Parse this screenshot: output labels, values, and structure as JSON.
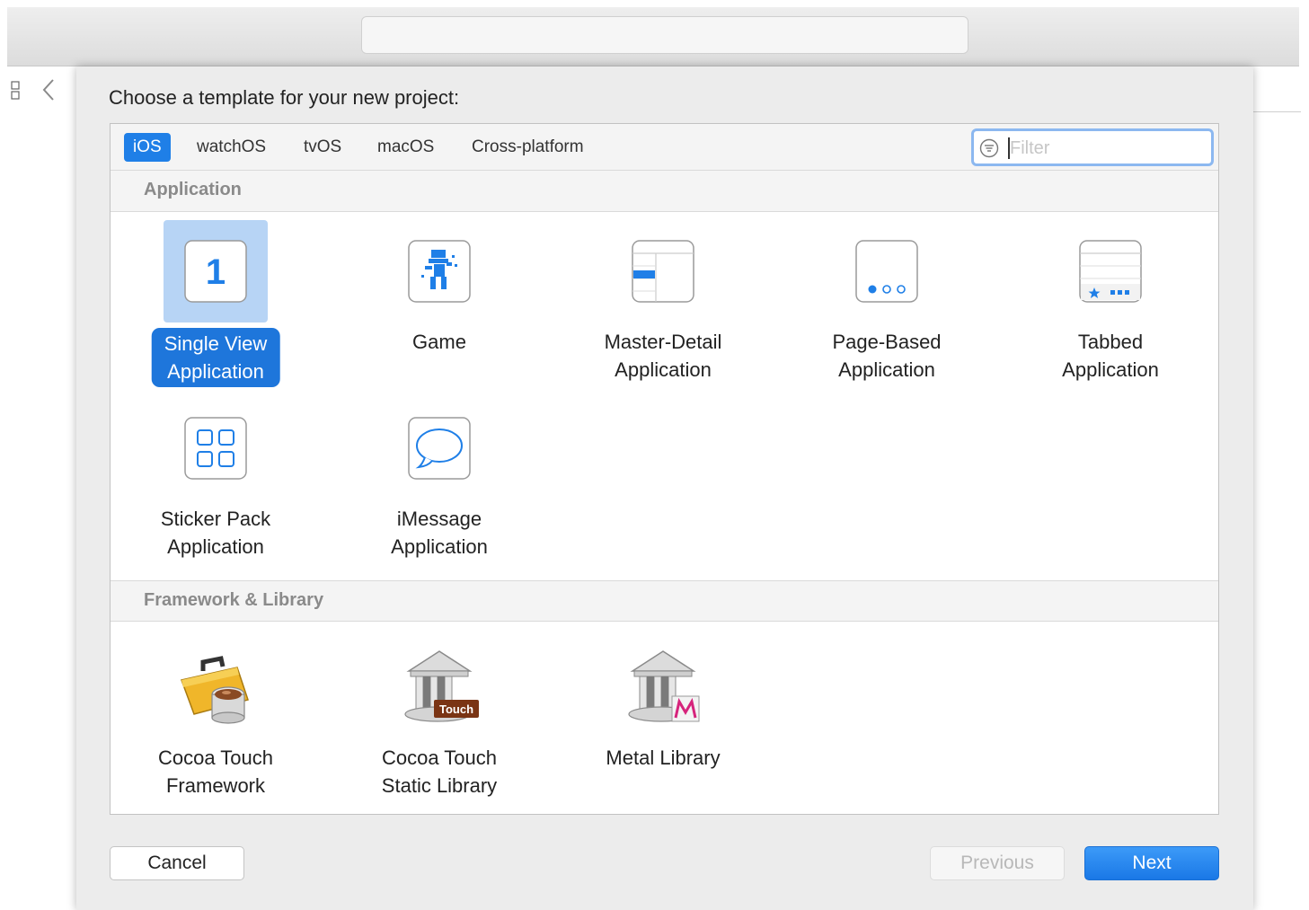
{
  "window": {
    "title_field": ""
  },
  "dialog": {
    "title": "Choose a template for your new project:",
    "platform_tabs": [
      {
        "label": "iOS",
        "selected": true
      },
      {
        "label": "watchOS",
        "selected": false
      },
      {
        "label": "tvOS",
        "selected": false
      },
      {
        "label": "macOS",
        "selected": false
      },
      {
        "label": "Cross-platform",
        "selected": false
      }
    ],
    "filter": {
      "placeholder": "Filter",
      "value": ""
    },
    "sections": [
      {
        "title": "Application",
        "templates": [
          {
            "line1": "Single View",
            "line2": "Application",
            "icon": "single-view-icon",
            "selected": true
          },
          {
            "line1": "Game",
            "line2": "",
            "icon": "game-icon",
            "selected": false
          },
          {
            "line1": "Master-Detail",
            "line2": "Application",
            "icon": "master-detail-icon",
            "selected": false
          },
          {
            "line1": "Page-Based",
            "line2": "Application",
            "icon": "page-based-icon",
            "selected": false
          },
          {
            "line1": "Tabbed",
            "line2": "Application",
            "icon": "tabbed-icon",
            "selected": false
          },
          {
            "line1": "Sticker Pack",
            "line2": "Application",
            "icon": "sticker-pack-icon",
            "selected": false
          },
          {
            "line1": "iMessage",
            "line2": "Application",
            "icon": "imessage-icon",
            "selected": false
          }
        ]
      },
      {
        "title": "Framework & Library",
        "templates": [
          {
            "line1": "Cocoa Touch",
            "line2": "Framework",
            "icon": "toolbox-icon",
            "selected": false
          },
          {
            "line1": "Cocoa Touch",
            "line2": "Static Library",
            "icon": "library-building-icon",
            "badge": "Touch",
            "selected": false
          },
          {
            "line1": "Metal Library",
            "line2": "",
            "icon": "metal-library-icon",
            "selected": false
          }
        ]
      }
    ],
    "single_view_number": "1",
    "buttons": {
      "cancel": "Cancel",
      "previous": "Previous",
      "next": "Next"
    }
  },
  "colors": {
    "accent": "#1f7fe7",
    "selection_fill": "#b7d4f5"
  }
}
